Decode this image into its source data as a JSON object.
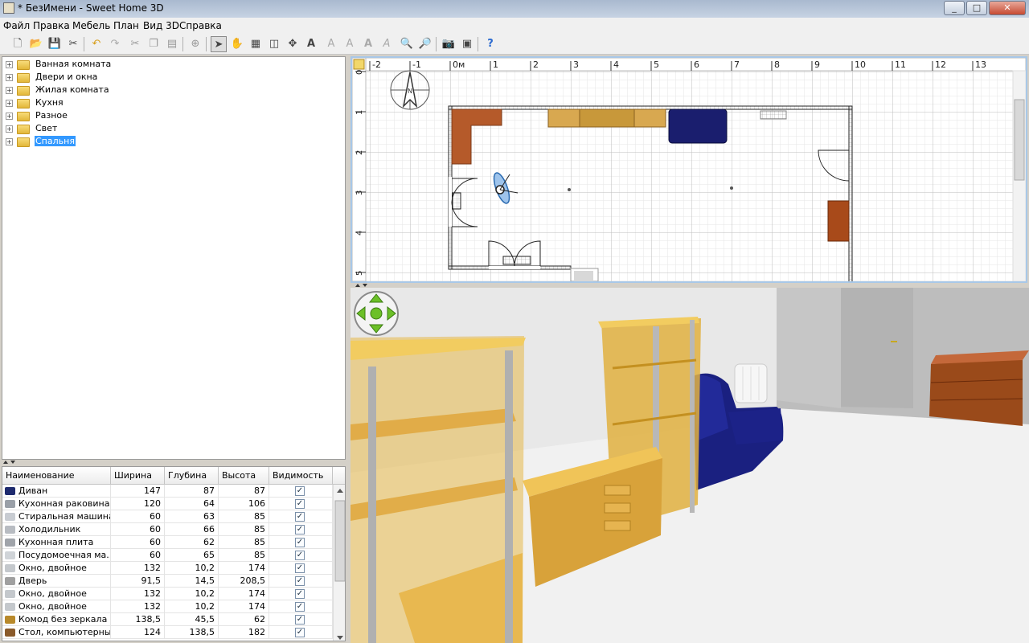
{
  "window": {
    "title": "* БезИмени - Sweet Home 3D",
    "min_icon": "minimize-icon",
    "max_icon": "maximize-icon",
    "close_icon": "close-icon"
  },
  "menu": [
    "Файл",
    "Правка",
    "Мебель",
    "План",
    "Вид 3D",
    "Справка"
  ],
  "toolbar_icons": [
    "new-file-icon",
    "open-folder-icon",
    "save-icon",
    "cut-tool-icon",
    "undo-icon",
    "redo-icon",
    "cut-icon",
    "copy-icon",
    "paste-icon",
    "add-furniture-icon",
    "select-arrow-icon",
    "pan-hand-icon",
    "create-walls-icon",
    "create-rooms-icon",
    "create-dimensions-icon",
    "add-text-icon",
    "text-size-icon",
    "text-style-icon",
    "bold-text-icon",
    "italic-text-icon",
    "zoom-in-icon",
    "zoom-out-icon",
    "create-photo-icon",
    "create-video-icon",
    "help-icon"
  ],
  "catalog": {
    "categories": [
      {
        "label": "Ванная комната",
        "selected": false
      },
      {
        "label": "Двери и окна",
        "selected": false
      },
      {
        "label": "Жилая комната",
        "selected": false
      },
      {
        "label": "Кухня",
        "selected": false
      },
      {
        "label": "Разное",
        "selected": false
      },
      {
        "label": "Свет",
        "selected": false
      },
      {
        "label": "Спальня",
        "selected": true
      }
    ]
  },
  "furniture_table": {
    "columns": [
      "Наименование",
      "Ширина",
      "Глубина",
      "Высота",
      "Видимость"
    ],
    "rows": [
      {
        "name": "Диван",
        "w": "147",
        "d": "87",
        "h": "87",
        "visible": true,
        "icon_color": "#1e2a6e"
      },
      {
        "name": "Кухонная раковина",
        "w": "120",
        "d": "64",
        "h": "106",
        "visible": true,
        "icon_color": "#9aa0a8"
      },
      {
        "name": "Стиральная машина",
        "w": "60",
        "d": "63",
        "h": "85",
        "visible": true,
        "icon_color": "#c8ccd2"
      },
      {
        "name": "Холодильник",
        "w": "60",
        "d": "66",
        "h": "85",
        "visible": true,
        "icon_color": "#b8bcc2"
      },
      {
        "name": "Кухонная плита",
        "w": "60",
        "d": "62",
        "h": "85",
        "visible": true,
        "icon_color": "#a0a4aa"
      },
      {
        "name": "Посудомоечная ма...",
        "w": "60",
        "d": "65",
        "h": "85",
        "visible": true,
        "icon_color": "#d0d4d8"
      },
      {
        "name": "Окно, двойное",
        "w": "132",
        "d": "10,2",
        "h": "174",
        "visible": true,
        "icon_color": "#c4c8cc"
      },
      {
        "name": "Дверь",
        "w": "91,5",
        "d": "14,5",
        "h": "208,5",
        "visible": true,
        "icon_color": "#a0a0a0"
      },
      {
        "name": "Окно, двойное",
        "w": "132",
        "d": "10,2",
        "h": "174",
        "visible": true,
        "icon_color": "#c4c8cc"
      },
      {
        "name": "Окно, двойное",
        "w": "132",
        "d": "10,2",
        "h": "174",
        "visible": true,
        "icon_color": "#c4c8cc"
      },
      {
        "name": "Комод без зеркала",
        "w": "138,5",
        "d": "45,5",
        "h": "62",
        "visible": true,
        "icon_color": "#b8892a"
      },
      {
        "name": "Стол, компьютерный",
        "w": "124",
        "d": "138,5",
        "h": "182",
        "visible": true,
        "icon_color": "#8a5a2a"
      }
    ]
  },
  "plan": {
    "ruler_x": [
      "-2",
      "-1",
      "0м",
      "1",
      "2",
      "3",
      "4",
      "5",
      "6",
      "7",
      "8",
      "9",
      "10",
      "11",
      "12",
      "13"
    ],
    "ruler_y": [
      "0м",
      "1",
      "2",
      "3",
      "4",
      "5"
    ],
    "compass_label": "N"
  },
  "view3d": {
    "nav_icon": "navigation-arrows-icon"
  }
}
